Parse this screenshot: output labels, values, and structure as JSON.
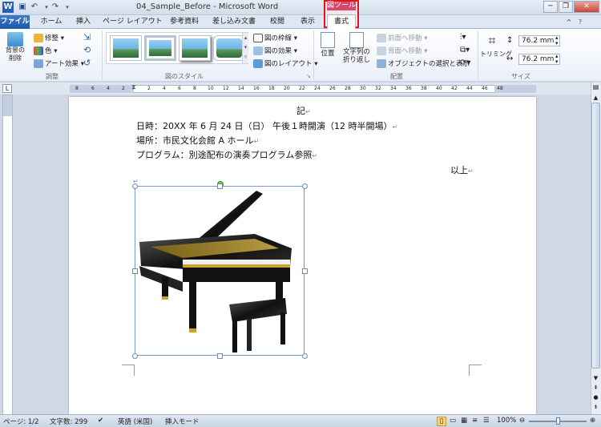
{
  "title": "04_Sample_Before - Microsoft Word",
  "context_tab": "図ツール",
  "tabs": [
    "ファイル",
    "ホーム",
    "挿入",
    "ページ レイアウト",
    "参考資料",
    "差し込み文書",
    "校閲",
    "表示",
    "書式"
  ],
  "ribbon": {
    "remove_bg": "背景の削除",
    "adjust": {
      "corrections": "修整",
      "color": "色",
      "artistic": "アート効果",
      "label": "調整"
    },
    "styles": {
      "border": "図の枠線",
      "effects": "図の効果",
      "layout": "図のレイアウト",
      "label": "図のスタイル"
    },
    "arrange": {
      "position": "位置",
      "wrap": "文字列の折り返し",
      "forward": "前面へ移動",
      "backward": "背面へ移動",
      "selection": "オブジェクトの選択と表示",
      "label": "配置"
    },
    "size": {
      "crop": "トリミング",
      "height": "76.2 mm",
      "width": "76.2 mm",
      "label": "サイズ"
    }
  },
  "document": {
    "heading": "記",
    "line1": "日時：20XX 年 6 月 24 日（日） 午後１時開演（12 時半開場）",
    "line2": "場所：市民文化会館 A ホール",
    "line3": "プログラム：別途配布の演奏プログラム参照",
    "closing": "以上"
  },
  "ruler_numbers": [
    "8",
    "6",
    "4",
    "2",
    "2",
    "4",
    "6",
    "8",
    "10",
    "12",
    "14",
    "16",
    "18",
    "20",
    "22",
    "24",
    "26",
    "28",
    "30",
    "32",
    "34",
    "36",
    "38",
    "40",
    "42",
    "44",
    "46",
    "48"
  ],
  "status": {
    "page": "ページ: 1/2",
    "words": "文字数: 299",
    "language": "英語 (米国)",
    "mode": "挿入モード",
    "zoom": "100%"
  }
}
